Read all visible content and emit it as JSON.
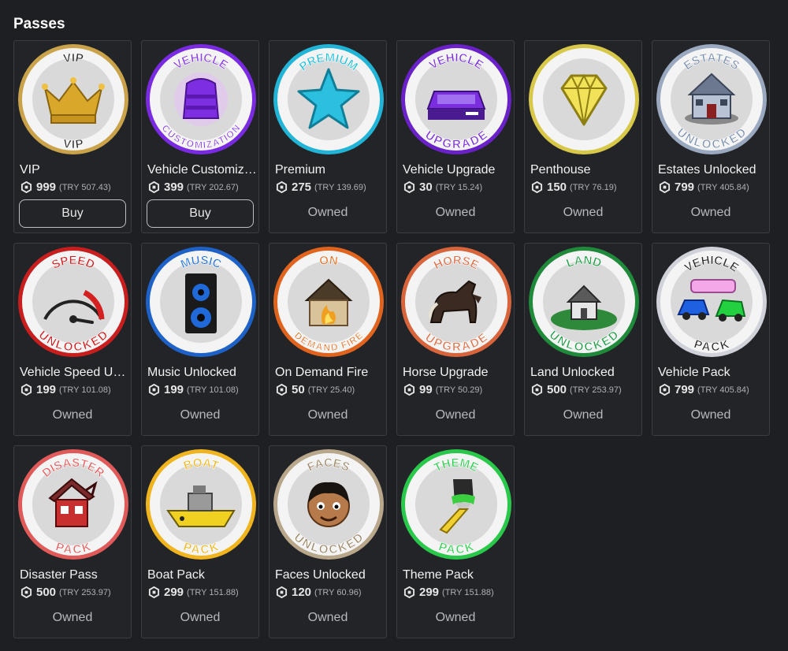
{
  "section": {
    "title": "Passes"
  },
  "passes": [
    {
      "id": "vip",
      "name": "VIP",
      "price": "999",
      "local": "(TRY 507.43)",
      "state": "buy",
      "action": "Buy",
      "ring": "#c9a24a",
      "top_label": "VIP",
      "bottom_label": "VIP",
      "label_color": "#2a2a2a",
      "icon": "crown-icon"
    },
    {
      "id": "vehicle-custom",
      "name": "Vehicle Customization",
      "price": "399",
      "local": "(TRY 202.67)",
      "state": "buy",
      "action": "Buy",
      "ring": "#7a2be2",
      "top_label": "VEHICLE",
      "bottom_label": "CUSTOMIZATION",
      "label_color": "#8a3cf0",
      "icon": "paint-canister-icon"
    },
    {
      "id": "premium",
      "name": "Premium",
      "price": "275",
      "local": "(TRY 139.69)",
      "state": "owned",
      "action": "Owned",
      "ring": "#22b4d6",
      "top_label": "PREMIUM",
      "bottom_label": "",
      "label_color": "#22c0e0",
      "icon": "star-icon"
    },
    {
      "id": "vehicle-upgrade",
      "name": "Vehicle Upgrade",
      "price": "30",
      "local": "(TRY 15.24)",
      "state": "owned",
      "action": "Owned",
      "ring": "#6a22c8",
      "top_label": "VEHICLE",
      "bottom_label": "UPGRADE",
      "label_color": "#7b2fe0",
      "icon": "car-upgrade-icon"
    },
    {
      "id": "penthouse",
      "name": "Penthouse",
      "price": "150",
      "local": "(TRY 76.19)",
      "state": "owned",
      "action": "Owned",
      "ring": "#d7c84a",
      "top_label": "",
      "bottom_label": "",
      "label_color": "#d7c84a",
      "icon": "diamond-icon"
    },
    {
      "id": "estates",
      "name": "Estates Unlocked",
      "price": "799",
      "local": "(TRY 405.84)",
      "state": "owned",
      "action": "Owned",
      "ring": "#9aa9bf",
      "top_label": "ESTATES",
      "bottom_label": "UNLOCKED",
      "label_color": "#7f93b3",
      "icon": "house-icon"
    },
    {
      "id": "speed",
      "name": "Vehicle Speed Unlocked",
      "price": "199",
      "local": "(TRY 101.08)",
      "state": "owned",
      "action": "Owned",
      "ring": "#c81e1e",
      "top_label": "SPEED",
      "bottom_label": "UNLOCKED",
      "label_color": "#d42020",
      "icon": "speedometer-icon"
    },
    {
      "id": "music",
      "name": "Music Unlocked",
      "price": "199",
      "local": "(TRY 101.08)",
      "state": "owned",
      "action": "Owned",
      "ring": "#1e62c8",
      "top_label": "MUSIC",
      "bottom_label": "",
      "label_color": "#2a78d8",
      "icon": "speaker-icon"
    },
    {
      "id": "fire",
      "name": "On Demand Fire",
      "price": "50",
      "local": "(TRY 25.40)",
      "state": "owned",
      "action": "Owned",
      "ring": "#e0641e",
      "top_label": "ON",
      "bottom_label": "DEMAND FIRE",
      "label_color": "#e8742a",
      "icon": "burning-house-icon"
    },
    {
      "id": "horse",
      "name": "Horse Upgrade",
      "price": "99",
      "local": "(TRY 50.29)",
      "state": "owned",
      "action": "Owned",
      "ring": "#d8643c",
      "top_label": "HORSE",
      "bottom_label": "UPGRADE",
      "label_color": "#e07048",
      "icon": "horse-icon"
    },
    {
      "id": "land",
      "name": "Land Unlocked",
      "price": "500",
      "local": "(TRY 253.97)",
      "state": "owned",
      "action": "Owned",
      "ring": "#1e8a3a",
      "top_label": "LAND",
      "bottom_label": "UNLOCKED",
      "label_color": "#22a048",
      "icon": "land-icon"
    },
    {
      "id": "vehicle-pack",
      "name": "Vehicle Pack",
      "price": "799",
      "local": "(TRY 405.84)",
      "state": "owned",
      "action": "Owned",
      "ring": "#cfd2d8",
      "top_label": "VEHICLE",
      "bottom_label": "PACK",
      "label_color": "#2a2a2a",
      "icon": "cars-icon"
    },
    {
      "id": "disaster",
      "name": "Disaster Pass",
      "price": "500",
      "local": "(TRY 253.97)",
      "state": "owned",
      "action": "Owned",
      "ring": "#e05a5a",
      "top_label": "DISASTER",
      "bottom_label": "PACK",
      "label_color": "#e86060",
      "icon": "broken-house-icon"
    },
    {
      "id": "boat",
      "name": "Boat Pack",
      "price": "299",
      "local": "(TRY 151.88)",
      "state": "owned",
      "action": "Owned",
      "ring": "#f0b41e",
      "top_label": "BOAT",
      "bottom_label": "PACK",
      "label_color": "#f2b822",
      "icon": "boat-icon"
    },
    {
      "id": "faces",
      "name": "Faces Unlocked",
      "price": "120",
      "local": "(TRY 60.96)",
      "state": "owned",
      "action": "Owned",
      "ring": "#b8a78a",
      "top_label": "FACES",
      "bottom_label": "UNLOCKED",
      "label_color": "#a08a6a",
      "icon": "face-icon"
    },
    {
      "id": "theme",
      "name": "Theme Pack",
      "price": "299",
      "local": "(TRY 151.88)",
      "state": "owned",
      "action": "Owned",
      "ring": "#2ac84a",
      "top_label": "THEME",
      "bottom_label": "PACK",
      "label_color": "#32d052",
      "icon": "paintbrush-icon"
    }
  ]
}
